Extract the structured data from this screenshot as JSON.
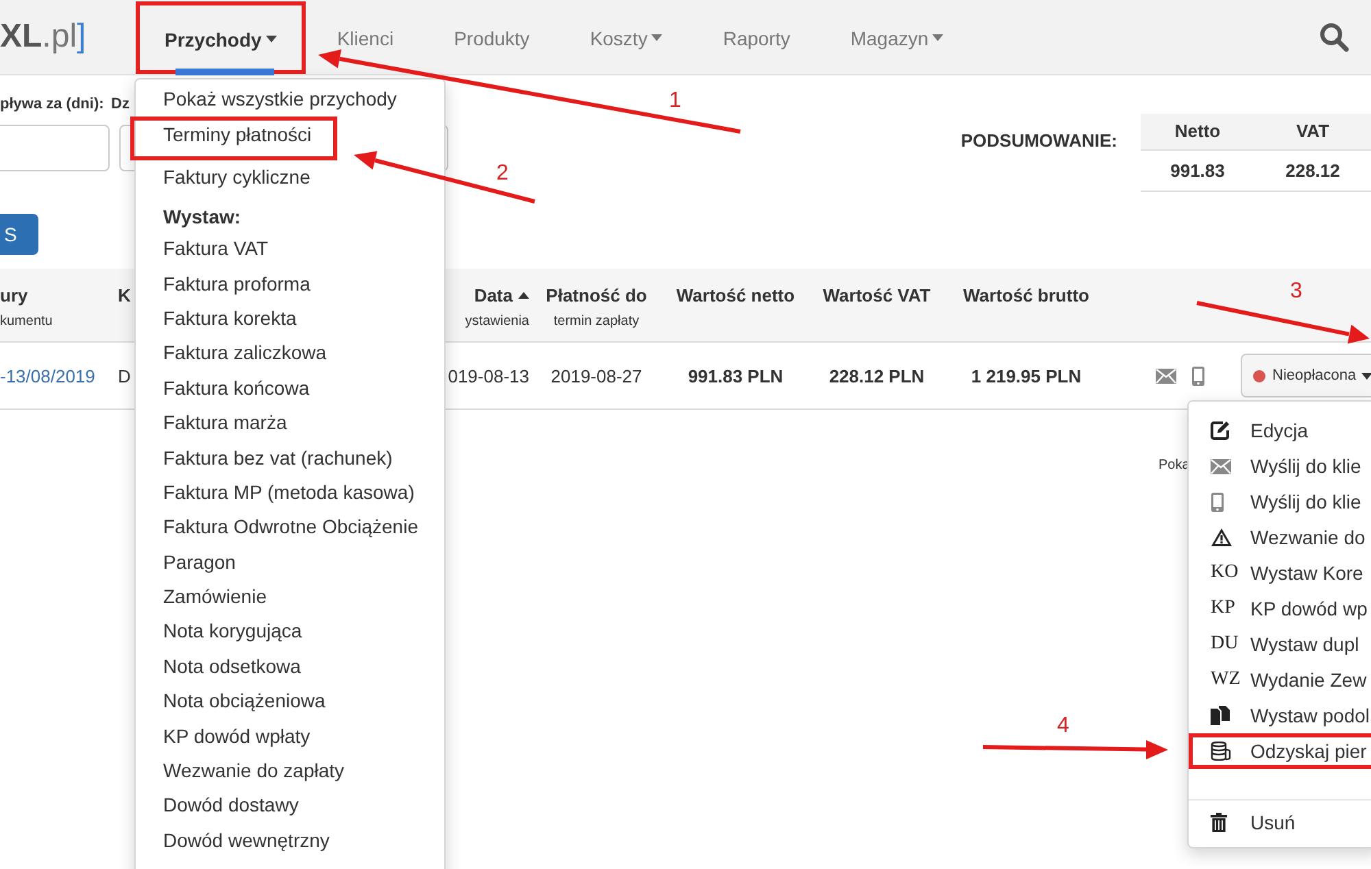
{
  "navbar": {
    "logo": {
      "main": "XL",
      "suffix": ".pl",
      "bracket": "]"
    },
    "items": [
      {
        "label": "Przychody",
        "dropdown": true,
        "selected": true,
        "highlighted": true
      },
      {
        "label": "Klienci",
        "dropdown": false,
        "selected": false,
        "highlighted": false
      },
      {
        "label": "Produkty",
        "dropdown": false,
        "selected": false,
        "highlighted": false
      },
      {
        "label": "Koszty",
        "dropdown": true,
        "selected": false,
        "highlighted": false
      },
      {
        "label": "Raporty",
        "dropdown": false,
        "selected": false,
        "highlighted": false
      },
      {
        "label": "Magazyn",
        "dropdown": true,
        "selected": false,
        "highlighted": false
      }
    ]
  },
  "filters": {
    "labels": [
      "pływa za (dni):",
      "Dz"
    ],
    "button": "S"
  },
  "summary": {
    "label": "PODSUMOWANIE:",
    "columns": [
      "Netto",
      "VAT"
    ],
    "values": [
      "991.83",
      "228.12"
    ]
  },
  "table": {
    "columns": [
      {
        "title": "ury",
        "subtitle": "kumentu"
      },
      {
        "title": "K"
      },
      {
        "title": "Data",
        "subtitle": "ystawienia",
        "sorted_ascending": true
      },
      {
        "title": "Płatność do",
        "subtitle": "termin zapłaty"
      },
      {
        "title": "Wartość netto"
      },
      {
        "title": "Wartość VAT"
      },
      {
        "title": "Wartość brutto"
      }
    ],
    "rows": [
      {
        "cells": [
          "-13/08/2019",
          "D",
          "019-08-13",
          "2019-08-27",
          "991.83 PLN",
          "228.12 PLN",
          "1 219.95 PLN"
        ],
        "status": "Nieopłacona"
      }
    ]
  },
  "footer_text": "Poka",
  "income_menu": [
    {
      "kind": "item",
      "label": "Pokaż wszystkie przychody",
      "highlighted": false
    },
    {
      "kind": "item",
      "label": "Terminy płatności",
      "highlighted": true
    },
    {
      "kind": "item",
      "label": "Faktury cykliczne",
      "highlighted": false
    },
    {
      "kind": "header",
      "label": "Wystaw:"
    },
    {
      "kind": "item",
      "label": "Faktura VAT",
      "highlighted": false
    },
    {
      "kind": "item",
      "label": "Faktura proforma",
      "highlighted": false
    },
    {
      "kind": "item",
      "label": "Faktura korekta",
      "highlighted": false
    },
    {
      "kind": "item",
      "label": "Faktura zaliczkowa",
      "highlighted": false
    },
    {
      "kind": "item",
      "label": "Faktura końcowa",
      "highlighted": false
    },
    {
      "kind": "item",
      "label": "Faktura marża",
      "highlighted": false
    },
    {
      "kind": "item",
      "label": "Faktura bez vat (rachunek)",
      "highlighted": false
    },
    {
      "kind": "item",
      "label": "Faktura MP (metoda kasowa)",
      "highlighted": false
    },
    {
      "kind": "item",
      "label": "Faktura Odwrotne Obciążenie",
      "highlighted": false
    },
    {
      "kind": "item",
      "label": "Paragon",
      "highlighted": false
    },
    {
      "kind": "item",
      "label": "Zamówienie",
      "highlighted": false
    },
    {
      "kind": "item",
      "label": "Nota korygująca",
      "highlighted": false
    },
    {
      "kind": "item",
      "label": "Nota odsetkowa",
      "highlighted": false
    },
    {
      "kind": "item",
      "label": "Nota obciążeniowa",
      "highlighted": false
    },
    {
      "kind": "item",
      "label": "KP dowód wpłaty",
      "highlighted": false
    },
    {
      "kind": "item",
      "label": "Wezwanie do zapłaty",
      "highlighted": false
    },
    {
      "kind": "item",
      "label": "Dowód dostawy",
      "highlighted": false
    },
    {
      "kind": "item",
      "label": "Dowód wewnętrzny",
      "highlighted": false
    }
  ],
  "actions_menu": [
    {
      "kind": "edit",
      "label": "Edycja",
      "highlighted": false
    },
    {
      "kind": "mail",
      "label": "Wyślij do klie",
      "highlighted": false
    },
    {
      "kind": "phone",
      "label": "Wyślij do klie",
      "highlighted": false
    },
    {
      "kind": "warning",
      "label": "Wezwanie do",
      "highlighted": false
    },
    {
      "kind": "code",
      "code": "KO",
      "label": "Wystaw Kore",
      "highlighted": false
    },
    {
      "kind": "code",
      "code": "KP",
      "label": "KP dowód wp",
      "highlighted": false
    },
    {
      "kind": "code",
      "code": "DU",
      "label": "Wystaw dupl",
      "highlighted": false
    },
    {
      "kind": "code",
      "code": "WZ",
      "label": "Wydanie Zew",
      "highlighted": false
    },
    {
      "kind": "copy",
      "label": "Wystaw podol",
      "highlighted": false
    },
    {
      "kind": "coins",
      "label": "Odzyskaj pier",
      "highlighted": true
    },
    {
      "kind": "divider"
    },
    {
      "kind": "trash",
      "label": "Usuń",
      "highlighted": false
    }
  ],
  "annotations": {
    "step_numbers": [
      "1",
      "2",
      "3",
      "4"
    ]
  }
}
